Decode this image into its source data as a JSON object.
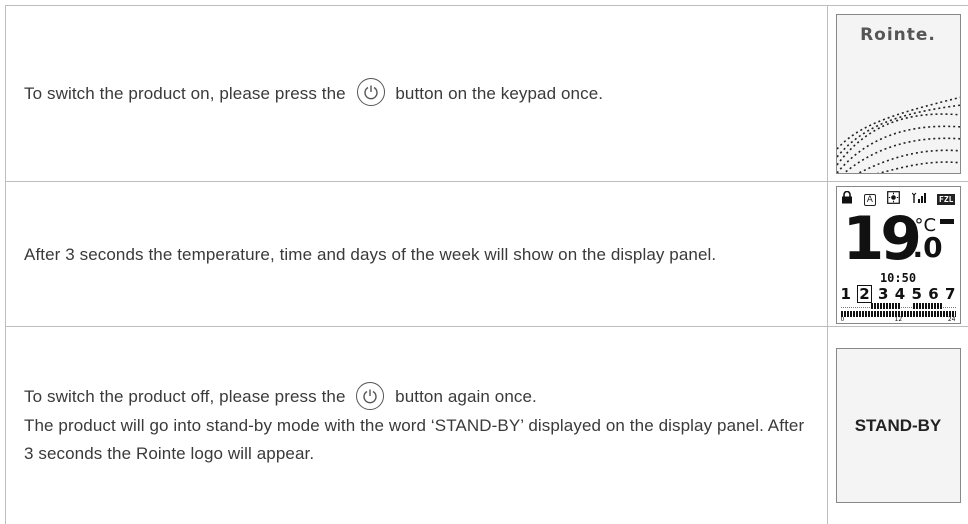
{
  "rows": [
    {
      "pre": "To switch the product on, please press the",
      "post": "button on the keypad once."
    },
    {
      "text": "After 3 seconds the temperature, time and days of the week will show on the display panel."
    },
    {
      "line1_pre": "To switch the product off, please press the",
      "line1_post": "button again once.",
      "line2": "The product will go into stand-by mode with the word ‘STAND-BY’ displayed on the display panel. After 3 seconds the Rointe logo will appear."
    }
  ],
  "screens": {
    "logo": "Rointe.",
    "lcd": {
      "fzl": "FZL",
      "temp": "19",
      "unit": "°C",
      "decimal": ".0",
      "time": "10:50",
      "days": [
        "1",
        "2",
        "3",
        "4",
        "5",
        "6",
        "7"
      ],
      "selected_day": "2",
      "axis": [
        "0",
        "12",
        "24"
      ]
    },
    "standby": "STAND-BY"
  },
  "icons": [
    "power-icon",
    "lock-icon",
    "a-mode-icon",
    "sun-icon",
    "signal-icon"
  ]
}
